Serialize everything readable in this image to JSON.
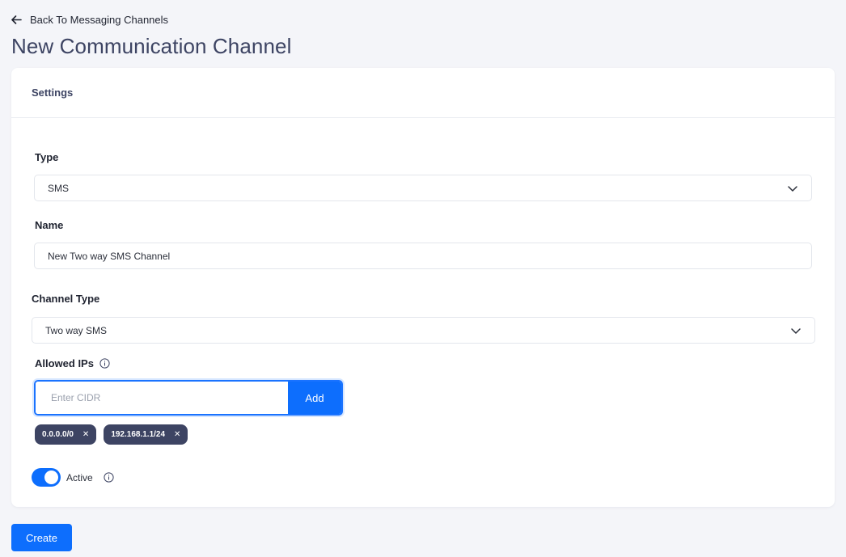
{
  "nav": {
    "back_label": "Back To Messaging Channels"
  },
  "page": {
    "title": "New Communication Channel"
  },
  "card": {
    "header": "Settings"
  },
  "form": {
    "type": {
      "label": "Type",
      "value": "SMS"
    },
    "name": {
      "label": "Name",
      "value": "New Two way SMS Channel"
    },
    "channel_type": {
      "label": "Channel Type",
      "value": "Two way SMS"
    },
    "allowed_ips": {
      "label": "Allowed IPs",
      "placeholder": "Enter CIDR",
      "add_label": "Add",
      "tags": [
        "0.0.0.0/0",
        "192.168.1.1/24"
      ]
    },
    "active": {
      "label": "Active",
      "enabled": true
    }
  },
  "actions": {
    "create_label": "Create"
  },
  "colors": {
    "primary": "#0d6efd",
    "tag_bg": "#3d4463",
    "title": "#3d4463",
    "background": "#f4f5f9"
  },
  "icons": {
    "back": "arrow-left-icon",
    "chevron": "chevron-down-icon",
    "info": "info-circle-icon",
    "remove": "close-icon"
  }
}
